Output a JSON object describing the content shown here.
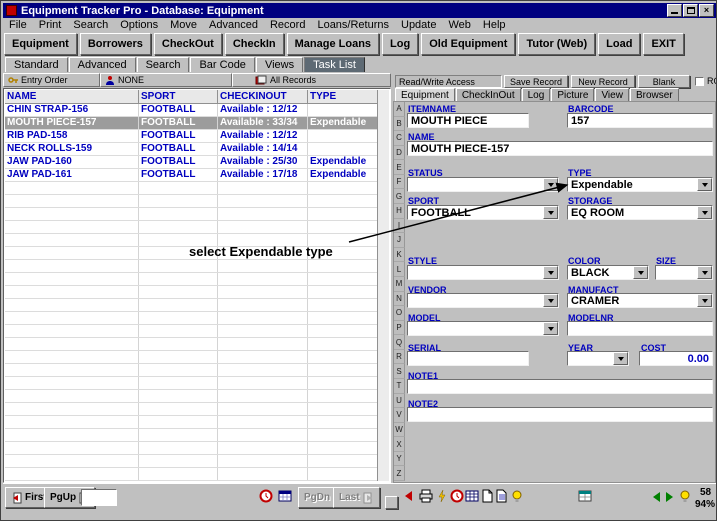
{
  "window": {
    "title": "Equipment Tracker Pro - Database: Equipment"
  },
  "menu": {
    "items": [
      "File",
      "Print",
      "Search",
      "Options",
      "Move",
      "Advanced",
      "Record",
      "Loans/Returns",
      "Update",
      "Web",
      "Help"
    ]
  },
  "toolbar": {
    "buttons": [
      "Equipment",
      "Borrowers",
      "CheckOut",
      "CheckIn",
      "Manage Loans",
      "Log",
      "Old Equipment",
      "Tutor (Web)",
      "Load",
      "EXIT"
    ]
  },
  "view_tabs": {
    "items": [
      "Standard",
      "Advanced",
      "Search",
      "Bar Code",
      "Views",
      "Task List"
    ],
    "active": "Task List"
  },
  "list": {
    "sort_bar": {
      "entry_order": "Entry Order",
      "none": "NONE",
      "all_records": "All Records"
    },
    "columns": [
      "NAME",
      "SPORT",
      "CHECKINOUT",
      "TYPE"
    ],
    "rows": [
      {
        "name": "CHIN STRAP-156",
        "sport": "FOOTBALL",
        "checkinout": "Available : 12/12",
        "type": "",
        "selected": false
      },
      {
        "name": "MOUTH PIECE-157",
        "sport": "FOOTBALL",
        "checkinout": "Available : 33/34",
        "type": "Expendable",
        "selected": true
      },
      {
        "name": "RIB PAD-158",
        "sport": "FOOTBALL",
        "checkinout": "Available : 12/12",
        "type": "",
        "selected": false
      },
      {
        "name": "NECK ROLLS-159",
        "sport": "FOOTBALL",
        "checkinout": "Available : 14/14",
        "type": "",
        "selected": false
      },
      {
        "name": "JAW PAD-160",
        "sport": "FOOTBALL",
        "checkinout": "Available : 25/30",
        "type": "Expendable",
        "selected": false
      },
      {
        "name": "JAW PAD-161",
        "sport": "FOOTBALL",
        "checkinout": "Available : 17/18",
        "type": "Expendable",
        "selected": false
      }
    ]
  },
  "nav": {
    "first": "First",
    "pgup": "PgUp",
    "pgdn": "PgDn",
    "last": "Last",
    "goto_value": ""
  },
  "detail": {
    "access_label": "Read/Write Access",
    "buttons": {
      "save": "Save Record",
      "new": "New Record",
      "blank": "Blank",
      "ro": "RO"
    },
    "tabs": [
      "Equipment",
      "CheckInOut",
      "Log",
      "Picture",
      "View",
      "Browser"
    ],
    "alphabet": [
      "A",
      "B",
      "C",
      "D",
      "E",
      "F",
      "G",
      "H",
      "I",
      "J",
      "K",
      "L",
      "M",
      "N",
      "O",
      "P",
      "Q",
      "R",
      "S",
      "T",
      "U",
      "V",
      "W",
      "X",
      "Y",
      "Z"
    ],
    "fields": {
      "itemname": {
        "label": "ITEMNAME",
        "value": "MOUTH PIECE"
      },
      "barcode": {
        "label": "BARCODE",
        "value": "157"
      },
      "name": {
        "label": "NAME",
        "value": "MOUTH PIECE-157"
      },
      "status": {
        "label": "STATUS",
        "value": ""
      },
      "type": {
        "label": "TYPE",
        "value": "Expendable"
      },
      "sport": {
        "label": "SPORT",
        "value": "FOOTBALL"
      },
      "storage": {
        "label": "STORAGE",
        "value": "EQ ROOM"
      },
      "style": {
        "label": "STYLE",
        "value": ""
      },
      "color": {
        "label": "COLOR",
        "value": "BLACK"
      },
      "size": {
        "label": "SIZE",
        "value": ""
      },
      "vendor": {
        "label": "VENDOR",
        "value": ""
      },
      "manufact": {
        "label": "MANUFACT",
        "value": "CRAMER"
      },
      "model": {
        "label": "MODEL",
        "value": ""
      },
      "modelnr": {
        "label": "MODELNR",
        "value": ""
      },
      "serial": {
        "label": "SERIAL",
        "value": ""
      },
      "year": {
        "label": "YEAR",
        "value": ""
      },
      "cost": {
        "label": "COST",
        "value": "0.00"
      },
      "note1": {
        "label": "NOTE1",
        "value": ""
      },
      "note2": {
        "label": "NOTE2",
        "value": ""
      }
    },
    "status_indicators": {
      "records": "58",
      "percent": "94%"
    }
  },
  "annotation": {
    "text": "select Expendable type"
  },
  "colors": {
    "titlebar": "#000080",
    "accent_blue": "#0000bf",
    "selected_row": "#9c9c9c"
  }
}
